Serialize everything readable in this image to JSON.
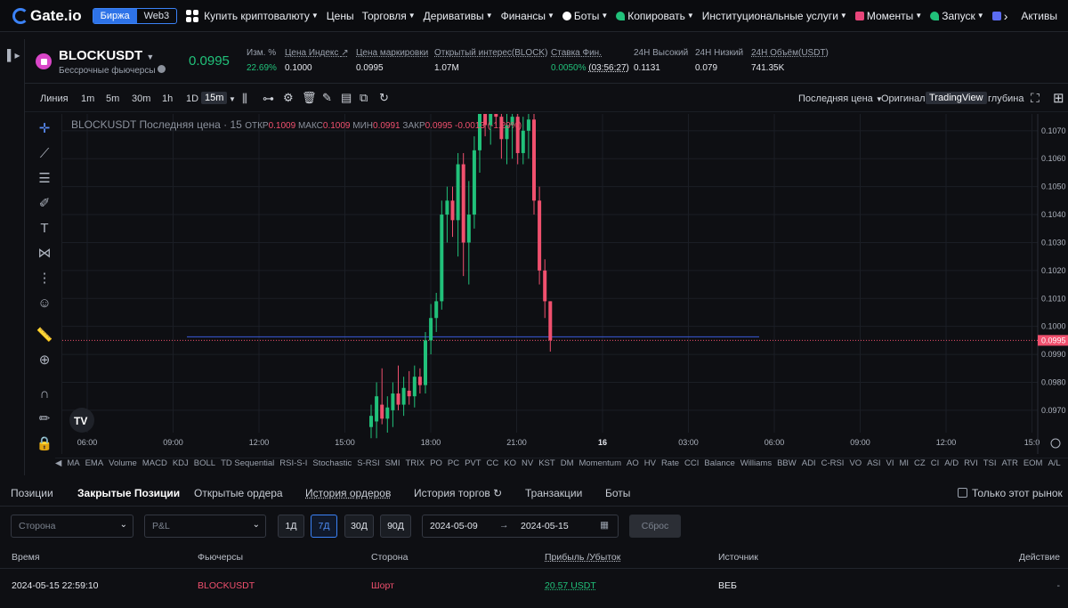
{
  "brand": "Gate.io",
  "topnav": {
    "exchange_toggle": [
      "Биржа",
      "Web3"
    ],
    "items": [
      "Купить криптовалюту",
      "Цены",
      "Торговля",
      "Деривативы",
      "Финансы",
      "Боты",
      "Копировать",
      "Институциональные услуги",
      "Моменты",
      "Запуск"
    ],
    "right": "Активы"
  },
  "ticker": {
    "symbol": "BLOCKUSDT",
    "subtitle": "Бессрочные фьючерсы",
    "price": "0.0995",
    "stats": [
      {
        "label": "Изм. %",
        "value": "22.69%"
      },
      {
        "label": "Цена Индекс",
        "value": "0.1000"
      },
      {
        "label": "Цена маркировки",
        "value": "0.0995"
      },
      {
        "label": "Открытый интерес(BLOCK)",
        "value": "1.07M"
      },
      {
        "label": "Ставка Фин.",
        "value": "0.0050%",
        "extra": "(03:56:27)"
      },
      {
        "label": "24H Высокий",
        "value": "0.1131"
      },
      {
        "label": "24H Низкий",
        "value": "0.079"
      },
      {
        "label": "24H Объём(USDT)",
        "value": "741.35K"
      }
    ]
  },
  "chart_toolbar": {
    "left": [
      "Линия",
      "1m",
      "5m",
      "30m",
      "1h",
      "1D",
      "15m"
    ],
    "selected": "15m",
    "price_type": "Последняя цена",
    "views": [
      "Оригинал",
      "TradingView",
      "глубина"
    ],
    "selected_view": "TradingView"
  },
  "chart_legend": {
    "title": "BLOCKUSDT Последняя цена · 15",
    "open_label": "ОТКР",
    "open": "0.1009",
    "high_label": "МАКС",
    "high": "0.1009",
    "low_label": "МИН",
    "low": "0.0991",
    "close_label": "ЗАКР",
    "close": "0.0995",
    "change": "-0.0013 (-1.29%)"
  },
  "chart_data": {
    "type": "candlestick",
    "x_ticks": [
      "06:00",
      "09:00",
      "12:00",
      "15:00",
      "18:00",
      "21:00",
      "16",
      "03:00",
      "06:00",
      "09:00",
      "12:00",
      "15:0"
    ],
    "y_ticks": [
      "0.1070",
      "0.1060",
      "0.1050",
      "0.1040",
      "0.1030",
      "0.1020",
      "0.1010",
      "0.1000",
      "0.0990",
      "0.0980",
      "0.0970"
    ],
    "current_price_label": "0.0995",
    "ylim": [
      0.0962,
      0.1076
    ],
    "candles": [
      {
        "o": 0.0964,
        "h": 0.0972,
        "l": 0.096,
        "c": 0.0968
      },
      {
        "o": 0.0966,
        "h": 0.098,
        "l": 0.096,
        "c": 0.0975
      },
      {
        "o": 0.0972,
        "h": 0.0985,
        "l": 0.0965,
        "c": 0.0967
      },
      {
        "o": 0.0967,
        "h": 0.0975,
        "l": 0.0962,
        "c": 0.0971
      },
      {
        "o": 0.097,
        "h": 0.098,
        "l": 0.0964,
        "c": 0.0976
      },
      {
        "o": 0.0976,
        "h": 0.0986,
        "l": 0.097,
        "c": 0.0972
      },
      {
        "o": 0.0972,
        "h": 0.0982,
        "l": 0.0968,
        "c": 0.0978
      },
      {
        "o": 0.0977,
        "h": 0.0984,
        "l": 0.0972,
        "c": 0.0975
      },
      {
        "o": 0.0975,
        "h": 0.0986,
        "l": 0.0971,
        "c": 0.0982
      },
      {
        "o": 0.0982,
        "h": 0.0985,
        "l": 0.0976,
        "c": 0.0979
      },
      {
        "o": 0.0979,
        "h": 0.0998,
        "l": 0.0976,
        "c": 0.0995
      },
      {
        "o": 0.0995,
        "h": 0.1008,
        "l": 0.099,
        "c": 0.1003
      },
      {
        "o": 0.1003,
        "h": 0.1012,
        "l": 0.0998,
        "c": 0.1009
      },
      {
        "o": 0.1009,
        "h": 0.1045,
        "l": 0.1006,
        "c": 0.104
      },
      {
        "o": 0.104,
        "h": 0.105,
        "l": 0.103,
        "c": 0.1045
      },
      {
        "o": 0.1045,
        "h": 0.105,
        "l": 0.1032,
        "c": 0.1038
      },
      {
        "o": 0.1038,
        "h": 0.1062,
        "l": 0.1025,
        "c": 0.1058
      },
      {
        "o": 0.1058,
        "h": 0.1062,
        "l": 0.1018,
        "c": 0.103
      },
      {
        "o": 0.103,
        "h": 0.1052,
        "l": 0.1015,
        "c": 0.104
      },
      {
        "o": 0.104,
        "h": 0.1068,
        "l": 0.1035,
        "c": 0.1063
      },
      {
        "o": 0.1063,
        "h": 0.108,
        "l": 0.1055,
        "c": 0.1078
      },
      {
        "o": 0.1078,
        "h": 0.1085,
        "l": 0.1068,
        "c": 0.1072
      },
      {
        "o": 0.1072,
        "h": 0.1082,
        "l": 0.1065,
        "c": 0.1079
      },
      {
        "o": 0.1079,
        "h": 0.1088,
        "l": 0.1072,
        "c": 0.1075
      },
      {
        "o": 0.1075,
        "h": 0.108,
        "l": 0.106,
        "c": 0.1067
      },
      {
        "o": 0.1067,
        "h": 0.1078,
        "l": 0.1058,
        "c": 0.1072
      },
      {
        "o": 0.1072,
        "h": 0.108,
        "l": 0.106,
        "c": 0.1075
      },
      {
        "o": 0.1075,
        "h": 0.1078,
        "l": 0.1058,
        "c": 0.1062
      },
      {
        "o": 0.1062,
        "h": 0.1075,
        "l": 0.1058,
        "c": 0.107
      },
      {
        "o": 0.107,
        "h": 0.1076,
        "l": 0.106,
        "c": 0.1074
      },
      {
        "o": 0.1074,
        "h": 0.1078,
        "l": 0.104,
        "c": 0.1045
      },
      {
        "o": 0.1045,
        "h": 0.105,
        "l": 0.1015,
        "c": 0.102
      },
      {
        "o": 0.102,
        "h": 0.1024,
        "l": 0.1003,
        "c": 0.1009
      },
      {
        "o": 0.1009,
        "h": 0.1009,
        "l": 0.0991,
        "c": 0.0995
      }
    ],
    "grid": true,
    "price_line": 0.0995
  },
  "indicators": [
    "MA",
    "EMA",
    "Volume",
    "MACD",
    "KDJ",
    "BOLL",
    "TD Sequential",
    "RSI-S-I",
    "Stochastic",
    "S-RSI",
    "SMI",
    "TRIX",
    "PO",
    "PC",
    "PVT",
    "CC",
    "KO",
    "NV",
    "KST",
    "DM",
    "Momentum",
    "AO",
    "HV",
    "Rate",
    "CCI",
    "Balance",
    "Williams",
    "BBW",
    "ADI",
    "C-RSI",
    "VO",
    "ASI",
    "VI",
    "MI",
    "CZ",
    "CI",
    "A/D",
    "RVI",
    "TSI",
    "ATR",
    "EOM",
    "A/L"
  ],
  "bottom_tabs": [
    "Позиции",
    "Закрытые Позиции",
    "Открытые ордера",
    "История ордеров",
    "История торгов",
    "Транзакции",
    "Боты"
  ],
  "active_tab": "Закрытые Позиции",
  "only_this_market": "Только этот рынок",
  "filters": {
    "side_placeholder": "Сторона",
    "pnl_placeholder": "P&L",
    "periods": [
      "1Д",
      "7Д",
      "30Д",
      "90Д"
    ],
    "active_period": "7Д",
    "date_from": "2024-05-09",
    "date_to": "2024-05-15",
    "reset": "Сброс"
  },
  "table": {
    "headers": [
      "Время",
      "Фьючерсы",
      "Сторона",
      "Прибыль /Убыток",
      "Источник",
      "Действие"
    ],
    "rows": [
      {
        "time": "2024-05-15 22:59:10",
        "contract": "BLOCKUSDT",
        "side": "Шорт",
        "pnl": "20.57 USDT",
        "source": "ВЕБ"
      }
    ]
  },
  "colors": {
    "up": "#21c17a",
    "down": "#f0506e",
    "accent": "#3b82f6"
  }
}
